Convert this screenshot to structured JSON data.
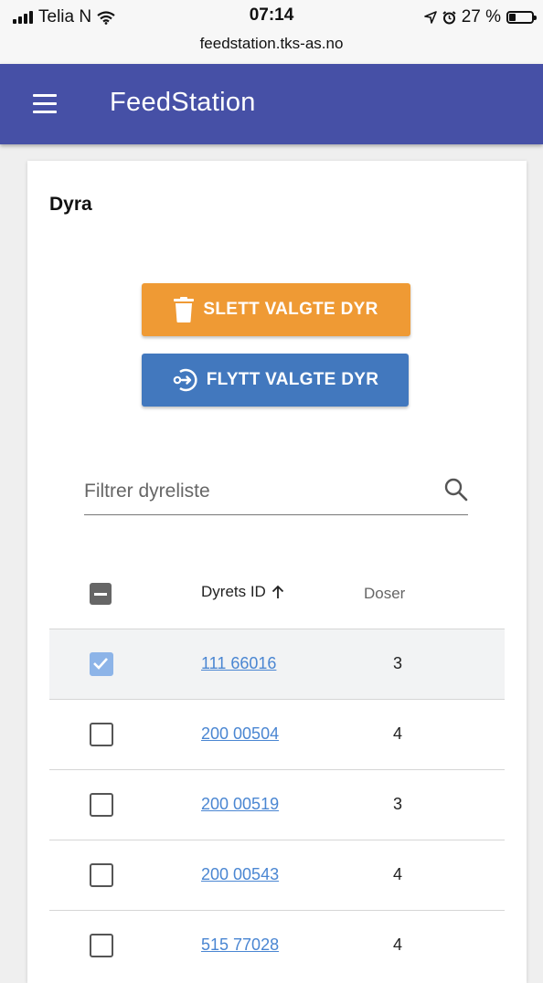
{
  "status_bar": {
    "carrier": "Telia N",
    "time": "07:14",
    "url": "feedstation.tks-as.no",
    "battery": "27 %",
    "battery_level": 0.27
  },
  "app_bar": {
    "title": "FeedStation",
    "menu_icon": "hamburger-menu-icon"
  },
  "card": {
    "title": "Dyra",
    "delete_button": {
      "label": "SLETT VALGTE DYR",
      "icon": "trash-icon",
      "color": "#ef9a34"
    },
    "move_button": {
      "label": "FLYTT VALGTE DYR",
      "icon": "move-icon",
      "color": "#4278be"
    },
    "filter": {
      "placeholder": "Filtrer dyreliste",
      "value": "",
      "icon": "search-icon"
    },
    "table": {
      "headers": {
        "id": "Dyrets ID",
        "sort_icon": "arrow-up-icon",
        "doses": "Doser"
      },
      "rows": [
        {
          "id": "111 66016",
          "doses": "3",
          "checked": true
        },
        {
          "id": "200 00504",
          "doses": "4",
          "checked": false
        },
        {
          "id": "200 00519",
          "doses": "3",
          "checked": false
        },
        {
          "id": "200 00543",
          "doses": "4",
          "checked": false
        },
        {
          "id": "515 77028",
          "doses": "4",
          "checked": false
        }
      ]
    }
  },
  "colors": {
    "app_bar": "#4650a6",
    "link": "#4a86d2",
    "checkbox_checked": "#8db4e8"
  }
}
